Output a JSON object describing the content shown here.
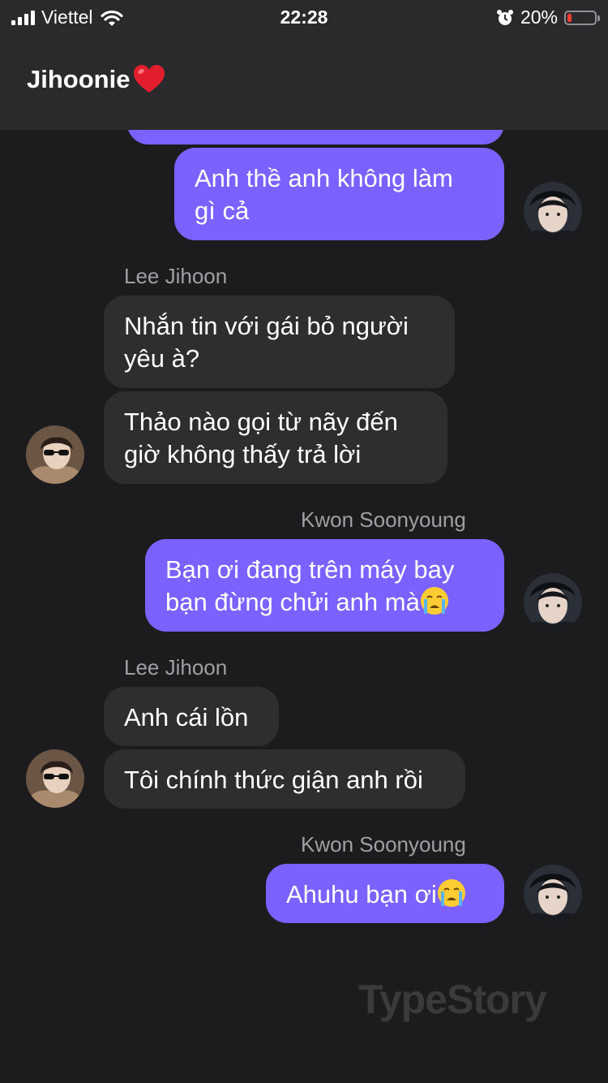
{
  "status_bar": {
    "carrier": "Viettel",
    "time": "22:28",
    "battery_percent": "20%",
    "battery_level": 0.2,
    "icons": [
      "signal-icon",
      "wifi-icon",
      "alarm-icon",
      "battery-icon"
    ]
  },
  "header": {
    "title": "Jihoonie",
    "title_emoji": "heart-icon",
    "heart_color": "#e21d2c"
  },
  "colors": {
    "outgoing_bubble": "#7b61ff",
    "incoming_bubble": "#2e2e30",
    "background": "#1c1c1e"
  },
  "messages": [
    {
      "text_line1": "Anh thề anh không làm",
      "text_line2": "gì cả"
    },
    {
      "sender": "Lee Jihoon"
    },
    {
      "text_line1": "Nhắn tin với gái bỏ người",
      "text_line2": "yêu à?"
    },
    {
      "text_line1": "Thảo nào gọi từ nãy đến",
      "text_line2": "giờ không thấy trả lời"
    },
    {
      "sender": "Kwon Soonyoung"
    },
    {
      "text_line1": "Bạn ơi đang trên máy bay",
      "text_line2": "bạn đừng chửi anh mà",
      "emoji": "crying-face-emoji"
    },
    {
      "sender": "Lee Jihoon"
    },
    {
      "text": "Anh cái lồn"
    },
    {
      "text": "Tôi chính thức giận anh rồi"
    },
    {
      "sender": "Kwon Soonyoung"
    },
    {
      "text": "Ahuhu bạn ơi",
      "emoji": "crying-face-emoji"
    }
  ],
  "watermark": "TypeStory"
}
